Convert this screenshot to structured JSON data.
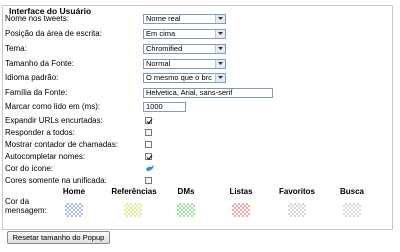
{
  "panel": {
    "legend": "Interface do Usuário"
  },
  "fields": {
    "tweet_names": {
      "label": "Nome nos tweets:",
      "value": "Nome real"
    },
    "compose_position": {
      "label": "Posição da área de escrita:",
      "value": "Em cima"
    },
    "theme": {
      "label": "Tema:",
      "value": "Chromified"
    },
    "font_size": {
      "label": "Tamanho da Fonte:",
      "value": "Normal"
    },
    "language": {
      "label": "Idioma padrão:",
      "value": "O mesmo que o brc"
    },
    "font_family": {
      "label": "Família da Fonte:",
      "value": "Helvetica, Arial, sans-serif"
    },
    "mark_read": {
      "label": "Marcar como lido em (ms):",
      "value": "1000"
    }
  },
  "checkboxes": {
    "expand_urls": {
      "label": "Expandir URLs encurtadas:",
      "checked": true
    },
    "reply_all": {
      "label": "Responder a todos:",
      "checked": false
    },
    "call_counter": {
      "label": "Mostrar contador de chamadas:",
      "checked": false
    },
    "autocomplete": {
      "label": "Autocompletar nomes:",
      "checked": true
    },
    "unread_colors": {
      "label": "Cores somente na unificada:",
      "checked": false
    }
  },
  "icon_color": {
    "label": "Cor do ícone:",
    "icon": "twitter-bird-icon"
  },
  "message_colors": {
    "label_line1": "Cor da",
    "label_line2": "mensagem:",
    "columns": [
      {
        "name": "Home",
        "color": "#aab8f0"
      },
      {
        "name": "Referências",
        "color": "#e6ec9a"
      },
      {
        "name": "DMs",
        "color": "#9ee6a0"
      },
      {
        "name": "Listas",
        "color": "#f0a8a8"
      },
      {
        "name": "Favoritos",
        "color": "#d6d6d6"
      },
      {
        "name": "Busca",
        "color": "#d6d6d6"
      }
    ]
  },
  "reset_button": {
    "label": "Resetar tamanho do Popup"
  }
}
